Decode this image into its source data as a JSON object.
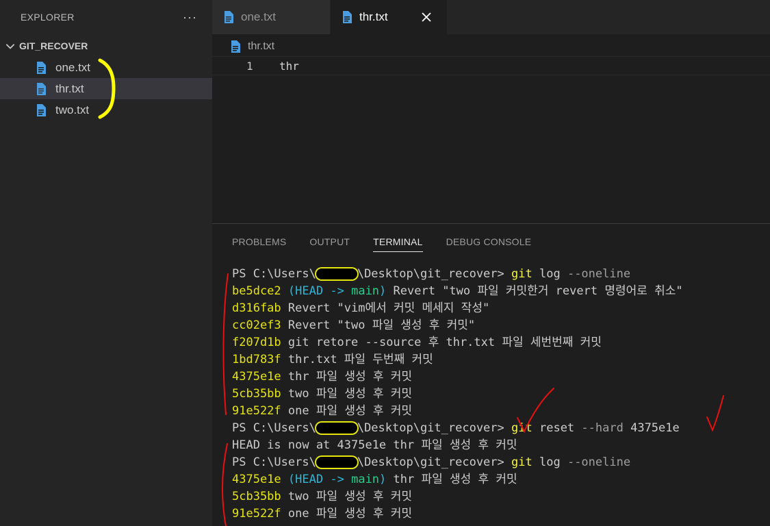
{
  "sidebar": {
    "title": "EXPLORER",
    "more": "···",
    "folder": "GIT_RECOVER",
    "files": [
      {
        "name": "one.txt"
      },
      {
        "name": "thr.txt",
        "selected": true
      },
      {
        "name": "two.txt"
      }
    ]
  },
  "tabs": [
    {
      "label": "one.txt",
      "active": false
    },
    {
      "label": "thr.txt",
      "active": true
    }
  ],
  "breadcrumb": {
    "file": "thr.txt"
  },
  "editor": {
    "lines": [
      {
        "num": "1",
        "text": "thr"
      }
    ]
  },
  "panel": {
    "tabs": [
      "PROBLEMS",
      "OUTPUT",
      "TERMINAL",
      "DEBUG CONSOLE"
    ],
    "active_tab": "TERMINAL"
  },
  "terminal": {
    "prompt_pre": "PS C:\\Users\\",
    "prompt_post": "\\Desktop\\git_recover>",
    "cmd1": {
      "git": "git",
      "rest": "log",
      "flag": "--oneline"
    },
    "log1": [
      {
        "hash": "be5dce2",
        "head": "HEAD",
        "arrow": "->",
        "branch": "main",
        "msg": "Revert \"two 파일 커밋한거 revert 명령어로 취소\""
      },
      {
        "hash": "d316fab",
        "msg": "Revert \"vim에서 커밋 메세지 작성\""
      },
      {
        "hash": "cc02ef3",
        "msg": "Revert \"two 파일 생성 후 커밋\""
      },
      {
        "hash": "f207d1b",
        "msg": "git retore --source 후 thr.txt 파일 세번번째 커밋"
      },
      {
        "hash": "1bd783f",
        "msg": "thr.txt 파일 두번째 커밋"
      },
      {
        "hash": "4375e1e",
        "msg": "thr 파일 생성 후 커밋"
      },
      {
        "hash": "5cb35bb",
        "msg": "two 파일 생성 후 커밋"
      },
      {
        "hash": "91e522f",
        "msg": "one 파일 생성 후 커밋"
      }
    ],
    "cmd2": {
      "git": "git",
      "rest": "reset",
      "flag": "--hard",
      "arg": "4375e1e"
    },
    "reset_output": "HEAD is now at 4375e1e thr 파일 생성 후 커밋",
    "cmd3": {
      "git": "git",
      "rest": "log",
      "flag": "--oneline"
    },
    "log2": [
      {
        "hash": "4375e1e",
        "head": "HEAD",
        "arrow": "->",
        "branch": "main",
        "msg": "thr 파일 생성 후 커밋"
      },
      {
        "hash": "5cb35bb",
        "msg": "two 파일 생성 후 커밋"
      },
      {
        "hash": "91e522f",
        "msg": "one 파일 생성 후 커밋"
      }
    ]
  },
  "colors": {
    "annotation_yellow": "#ffff00",
    "annotation_red": "#e81010",
    "file_icon": "#4a9de0"
  }
}
